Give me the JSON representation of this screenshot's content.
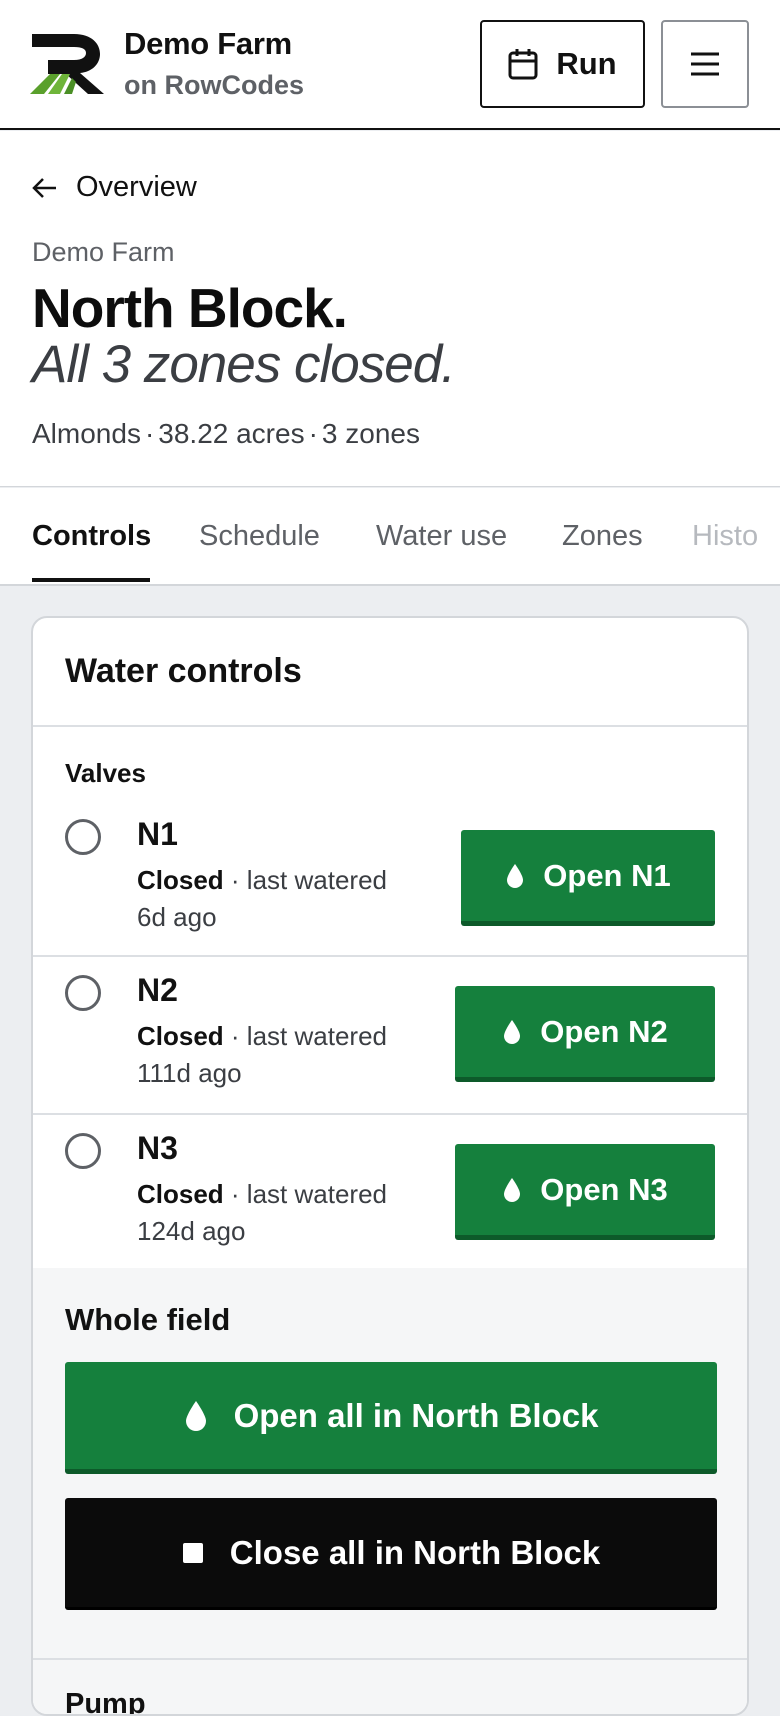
{
  "header": {
    "brand_name": "Demo Farm",
    "brand_sub": "on RowCodes",
    "run_label": "Run",
    "accent_green": "#15803d"
  },
  "hero": {
    "back_label": "Overview",
    "crumb": "Demo Farm",
    "title": "North Block.",
    "subtitle": "All 3 zones closed.",
    "crop": "Almonds",
    "acres": "38.22 acres",
    "zones": "3 zones",
    "separator": "·"
  },
  "tabs": [
    "Controls",
    "Schedule",
    "Water use",
    "Zones",
    "Histo"
  ],
  "active_tab": "Controls",
  "card": {
    "title": "Water controls",
    "valves_label": "Valves",
    "valves": [
      {
        "name": "N1",
        "status": "Closed",
        "detail": "· last watered",
        "ago": "6d ago",
        "button": "Open N1"
      },
      {
        "name": "N2",
        "status": "Closed",
        "detail": "· last watered",
        "ago": "111d ago",
        "button": "Open N2"
      },
      {
        "name": "N3",
        "status": "Closed",
        "detail": "· last watered",
        "ago": "124d ago",
        "button": "Open N3"
      }
    ],
    "whole_field": {
      "title": "Whole field",
      "open_all": "Open all in North Block",
      "close_all": "Close all in North Block"
    },
    "pump_label": "Pump"
  }
}
